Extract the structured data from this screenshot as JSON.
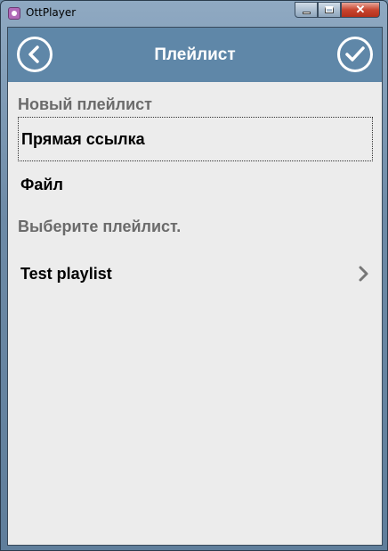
{
  "window": {
    "title": "OttPlayer"
  },
  "header": {
    "title": "Плейлист",
    "back_icon": "chevron-left-circle-icon",
    "confirm_icon": "check-circle-icon"
  },
  "content": {
    "new_playlist_label": "Новый плейлист",
    "new_options": [
      {
        "label": "Прямая ссылка",
        "selected": true
      },
      {
        "label": "Файл",
        "selected": false
      }
    ],
    "choose_label": "Выберите плейлист.",
    "playlists": [
      {
        "label": "Test playlist"
      }
    ]
  },
  "colors": {
    "header_bg": "#5f87a8",
    "client_bg": "#ececec",
    "section_text": "#6b6b6b"
  }
}
